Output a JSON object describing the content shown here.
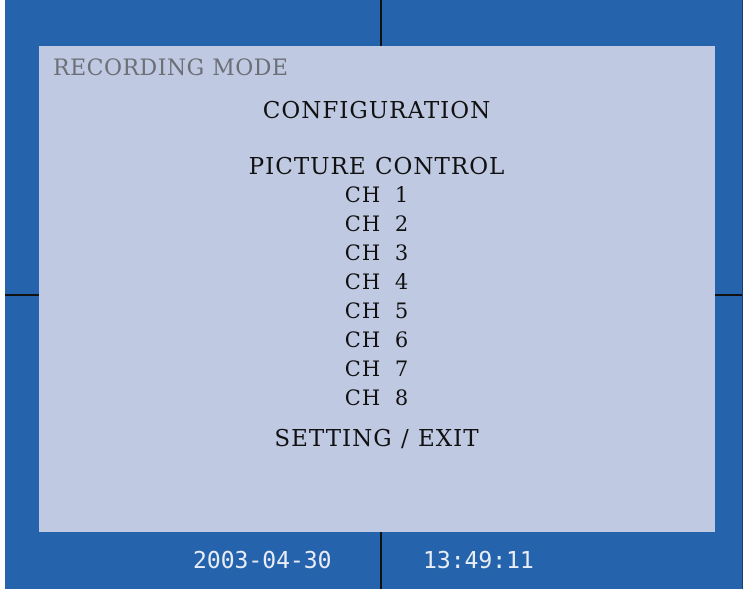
{
  "panel": {
    "title": "RECORDING MODE",
    "menu": {
      "configuration": "CONFIGURATION",
      "picture_control": "PICTURE CONTROL",
      "channels": [
        "CH 1",
        "CH 2",
        "CH 3",
        "CH 4",
        "CH 5",
        "CH 6",
        "CH 7",
        "CH 8"
      ],
      "setting_exit": "SETTING / EXIT"
    }
  },
  "status_bar": {
    "date": "2003-04-30",
    "time": "13:49:11"
  },
  "colors": {
    "screen_background": "#2563ad",
    "panel_background": "#bfc9e2",
    "title_text": "#6c6f76",
    "menu_text": "#111111",
    "status_text": "#e8ecf5"
  }
}
